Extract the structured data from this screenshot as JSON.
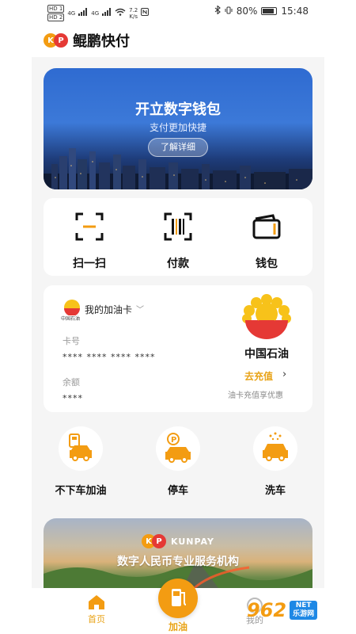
{
  "status_bar": {
    "sim1": "HD 1",
    "sim2": "HD 2",
    "net1": "4G",
    "net2": "4G",
    "speed": "7.2",
    "speed_unit": "K/s",
    "battery": "80%",
    "time": "15:48"
  },
  "app": {
    "logo_text": "KP",
    "title": "鲲鹏快付"
  },
  "banner": {
    "title": "开立数字钱包",
    "subtitle": "支付更加快捷",
    "button": "了解详细"
  },
  "quick_actions": [
    {
      "label": "扫一扫",
      "icon": "scan-icon"
    },
    {
      "label": "付款",
      "icon": "barcode-icon"
    },
    {
      "label": "钱包",
      "icon": "wallet-icon"
    }
  ],
  "fuel_card": {
    "brand_small": "中国石油",
    "title": "我的加油卡",
    "card_no_label": "卡号",
    "card_no": "**** **** **** ****",
    "balance_label": "余额",
    "balance": "****",
    "brand": "中国石油",
    "recharge": "去充值",
    "recharge_arrow": "›",
    "recharge_tip": "油卡充值享优惠"
  },
  "services": [
    {
      "label": "不下车加油",
      "icon": "gas-car-icon"
    },
    {
      "label": "停车",
      "icon": "parking-car-icon"
    },
    {
      "label": "洗车",
      "icon": "car-wash-icon"
    }
  ],
  "promo": {
    "logo_text": "KUNPAY",
    "title": "数字人民币专业服务机构"
  },
  "tab_bar": {
    "home": "首页",
    "fuel": "加油",
    "mine": "我的"
  },
  "watermark": {
    "number": "962",
    "net": "NET",
    "cn": "乐游网"
  },
  "colors": {
    "accent": "#F39C12",
    "highlight": "#E8A317",
    "cnpc_red": "#E53935",
    "cnpc_yellow": "#F7C21A"
  }
}
